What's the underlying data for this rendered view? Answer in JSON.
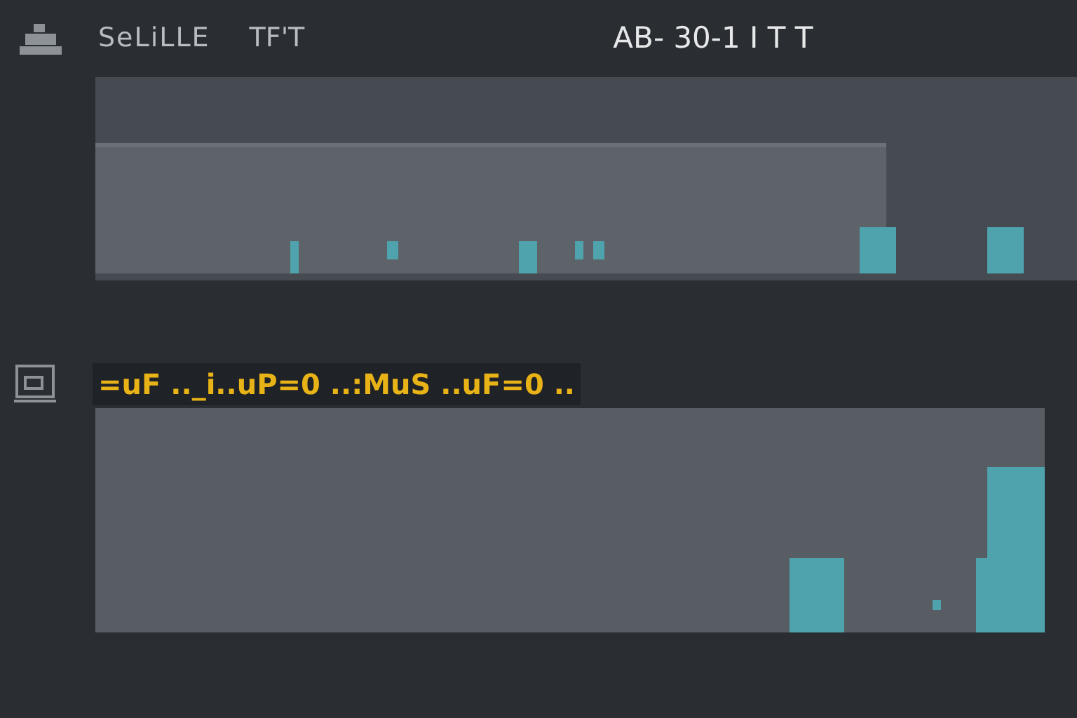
{
  "header": {
    "title": "SeLiLLE",
    "subtitle": "TF'T",
    "status": "AB- 30-1 I T T"
  },
  "section": {
    "label": "=uF .._i..uP=0 ..:MuS ..uF=0 .."
  }
}
